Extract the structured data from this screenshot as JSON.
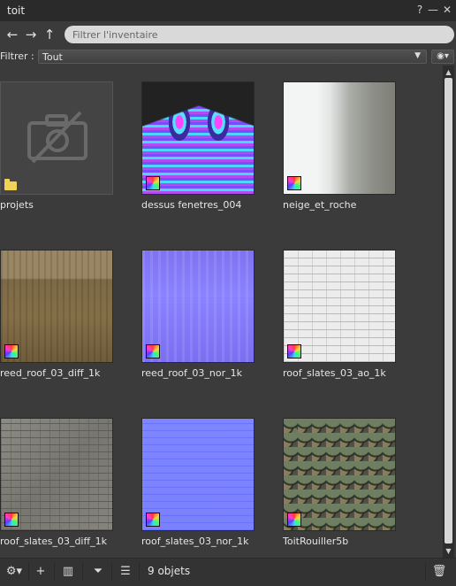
{
  "window": {
    "title": "toit"
  },
  "titlebar": {
    "help_label": "?",
    "minimize_label": "—",
    "close_label": "✕"
  },
  "nav": {
    "back_label": "←",
    "forward_label": "→",
    "up_label": "↑"
  },
  "search": {
    "placeholder": "Filtrer l'inventaire",
    "value": ""
  },
  "filter": {
    "label": "Filtrer :",
    "selected": "Tout"
  },
  "items": [
    {
      "name": "projets",
      "type": "folder"
    },
    {
      "name": "dessus fenetres_004",
      "type": "texture"
    },
    {
      "name": "neige_et_roche",
      "type": "texture"
    },
    {
      "name": "reed_roof_03_diff_1k",
      "type": "texture"
    },
    {
      "name": "reed_roof_03_nor_1k",
      "type": "texture"
    },
    {
      "name": "roof_slates_03_ao_1k",
      "type": "texture"
    },
    {
      "name": "roof_slates_03_diff_1k",
      "type": "texture"
    },
    {
      "name": "roof_slates_03_nor_1k",
      "type": "texture"
    },
    {
      "name": "ToitRouiller5b",
      "type": "texture"
    }
  ],
  "status": {
    "count": "9 objets"
  },
  "icons": {
    "settings": "gear-icon",
    "add": "plus-icon",
    "view": "gallery-icon",
    "filter": "funnel-icon",
    "sort": "list-icon",
    "trash": "trash-icon",
    "visibility": "eye-icon"
  }
}
